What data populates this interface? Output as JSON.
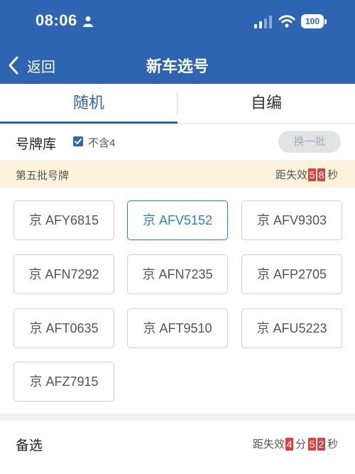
{
  "status_bar": {
    "time": "08:06",
    "battery": "100"
  },
  "nav": {
    "back_label": "返回",
    "title": "新车选号"
  },
  "tabs": [
    {
      "label": "随机",
      "active": true
    },
    {
      "label": "自编",
      "active": false
    }
  ],
  "pool": {
    "title": "号牌库",
    "exclude_four_label": "不含4",
    "exclude_four_checked": true,
    "refresh_label": "换一批"
  },
  "batch": {
    "title": "第五批号牌",
    "countdown_prefix": "距失效",
    "seconds_digits": [
      "5",
      "8"
    ],
    "seconds_unit": "秒"
  },
  "plates": [
    {
      "label": "京 AFY6815",
      "selected": false
    },
    {
      "label": "京 AFV5152",
      "selected": true
    },
    {
      "label": "京 AFV9303",
      "selected": false
    },
    {
      "label": "京 AFN7292",
      "selected": false
    },
    {
      "label": "京 AFN7235",
      "selected": false
    },
    {
      "label": "京 AFP2705",
      "selected": false
    },
    {
      "label": "京 AFT0635",
      "selected": false
    },
    {
      "label": "京 AFT9510",
      "selected": false
    },
    {
      "label": "京 AFU5223",
      "selected": false
    },
    {
      "label": "京 AFZ7915",
      "selected": false
    }
  ],
  "alternates": {
    "title": "备选",
    "countdown_prefix": "距失效",
    "minutes_digits": [
      "4"
    ],
    "minutes_unit": "分",
    "seconds_digits": [
      "5",
      "2"
    ],
    "seconds_unit": "秒"
  },
  "colors": {
    "brand": "#2d65b3",
    "selected_plate": "#2d80c8",
    "countdown_digit_bg": "#e0403a",
    "banner_bg": "#fdf3dc"
  }
}
